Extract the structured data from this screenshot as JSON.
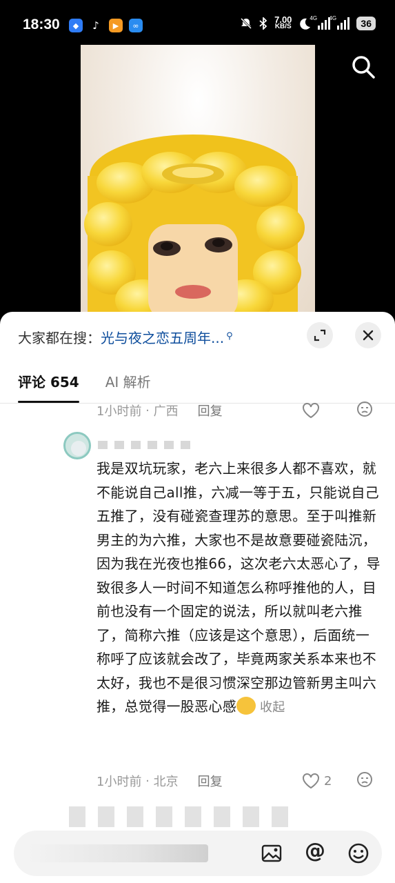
{
  "status_bar": {
    "time": "18:30",
    "net_speed_value": "7.00",
    "net_speed_unit": "KB/S",
    "signal_label_1": "4G",
    "signal_label_2": "4G",
    "battery": "36"
  },
  "sheet": {
    "hot_search_label": "大家都在搜：",
    "hot_search_keyword": "光与夜之恋五周年...",
    "tabs": [
      {
        "label": "评论 654"
      },
      {
        "label": "AI 解析"
      }
    ]
  },
  "comments": [
    {
      "time": "1小时前",
      "location": "广西",
      "reply_label": "回复"
    },
    {
      "text": "我是双坑玩家，老六上来很多人都不喜欢，就不能说自己all推，六减一等于五，只能说自己五推了，没有碰瓷查理苏的意思。至于叫推新男主的为六推，大家也不是故意要碰瓷陆沉，因为我在光夜也推66，这次老六太恶心了，导致很多人一时间不知道怎么称呼推他的人，目前也没有一个固定的说法，所以就叫老六推了，简称六推（应该是这个意思），后面统一称呼了应该就会改了，毕竟两家关系本来也不太好，我也不是很习惯深空那边管新男主叫六推，总觉得一股恶心感",
      "collapse_label": "收起",
      "time": "1小时前",
      "location": "北京",
      "reply_label": "回复",
      "like_count": "2"
    }
  ],
  "colors": {
    "keyword": "#0d4d9c",
    "corn_yellow": "#f5cf2c"
  }
}
